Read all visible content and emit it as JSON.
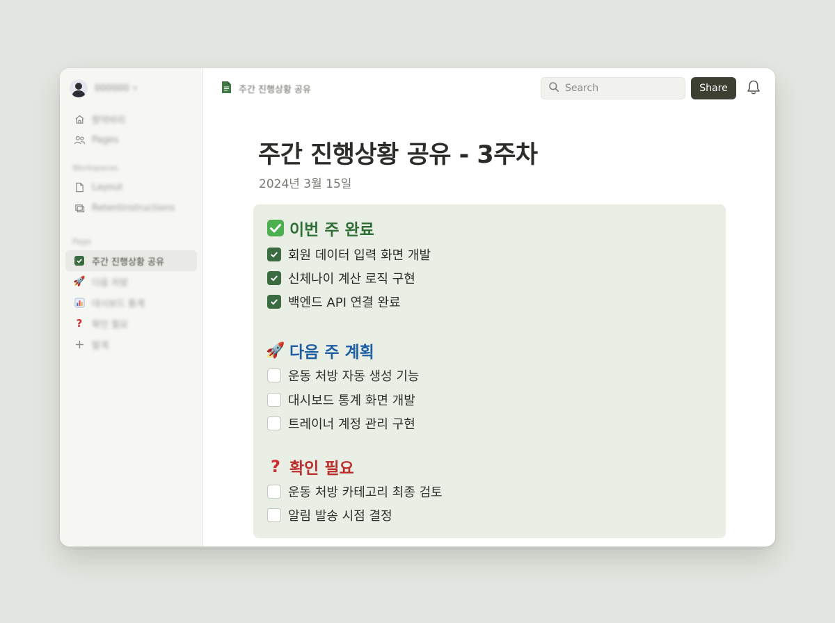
{
  "sidebar": {
    "user_name": "000000",
    "items": [
      {
        "label": "향약바리",
        "icon": "home-icon"
      },
      {
        "label": "Pages",
        "icon": "people-icon"
      }
    ],
    "workspaces_label": "Workspaces",
    "workspaces": [
      {
        "label": "Layout",
        "icon": "page-icon"
      },
      {
        "label": "Retentinstructions",
        "icon": "stack-icon"
      }
    ],
    "page_label": "Page",
    "pages": [
      {
        "label": "주간 진행상황 공유",
        "icon": "checkbox-icon"
      },
      {
        "label": "다음 처방",
        "icon": "rocket-icon"
      },
      {
        "label": "대시보드 통계",
        "icon": "chart-icon"
      },
      {
        "label": "확인 필요",
        "icon": "question-icon"
      },
      {
        "label": "발게",
        "icon": "plus-icon"
      }
    ]
  },
  "topbar": {
    "breadcrumb": "주간 진행상황 공유",
    "search_placeholder": "Search",
    "share_label": "Share"
  },
  "document": {
    "title": "주간 진행상황 공유 - 3주차",
    "date": "2024년 3월 15일",
    "sections": [
      {
        "heading": "이번 주 완료",
        "icon": "check-mark-icon",
        "color": "#2f6f37",
        "tasks": [
          {
            "label": "회원 데이터 입력 화면 개발",
            "done": true
          },
          {
            "label": "신체나이 계산 로직 구현",
            "done": true
          },
          {
            "label": "백엔드 API 연결 완료",
            "done": true
          }
        ]
      },
      {
        "heading": "다음 주 계획",
        "icon": "rocket-icon",
        "color": "#1e5fa3",
        "tasks": [
          {
            "label": "운동 처방 자동 생성 기능",
            "done": false
          },
          {
            "label": "대시보드 통계 화면 개발",
            "done": false
          },
          {
            "label": "트레이너 계정 관리 구현",
            "done": false
          }
        ]
      },
      {
        "heading": "확인 필요",
        "icon": "question-mark-icon",
        "color": "#bb2e2e",
        "tasks": [
          {
            "label": "운동 처방 카테고리 최종 검토",
            "done": false
          },
          {
            "label": "알림 발송 시점 결정",
            "done": false
          }
        ]
      }
    ]
  }
}
